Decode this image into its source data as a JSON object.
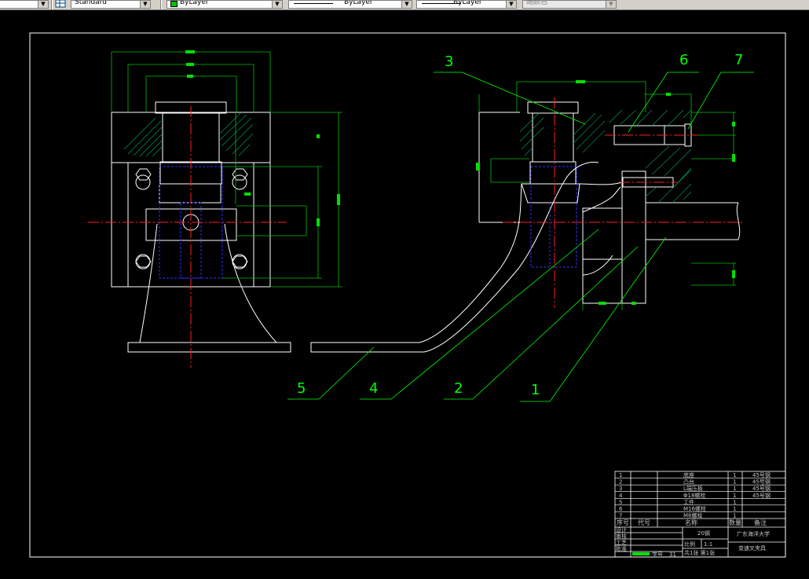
{
  "toolbar": {
    "text_style": "Standard",
    "layer_color": "ByLayer",
    "linetype": "ByLayer",
    "lineweight": "ByLayer",
    "plot_style": "随颜色"
  },
  "drawing": {
    "balloons": [
      "1",
      "2",
      "3",
      "4",
      "5",
      "6",
      "7"
    ]
  },
  "title_block": {
    "parts": [
      {
        "no": "1",
        "name": "底座",
        "qty": "1",
        "material": "45号钢"
      },
      {
        "no": "2",
        "name": "凸台",
        "qty": "1",
        "material": "45号钢"
      },
      {
        "no": "3",
        "name": "L端压板",
        "qty": "1",
        "material": "45号钢"
      },
      {
        "no": "4",
        "name": "Φ18螺栓",
        "qty": "1",
        "material": "45号钢"
      },
      {
        "no": "5",
        "name": "工件",
        "qty": "1",
        "material": ""
      },
      {
        "no": "6",
        "name": "M16螺栓",
        "qty": "1",
        "material": ""
      },
      {
        "no": "7",
        "name": "M8螺栓",
        "qty": "1",
        "material": ""
      }
    ],
    "header": {
      "seq": "序号",
      "code": "代号",
      "name": "名称",
      "qty": "数量",
      "note": "备注"
    },
    "fields": {
      "designer": "设计",
      "checker": "审核",
      "technologist": "工艺",
      "approver": "批准",
      "material": "20钢",
      "university": "广东海洋大学",
      "scale_label": "比例",
      "scale": "1:1",
      "sheets": "共1张  第1张",
      "part_name": "变速叉夹具",
      "student_no_label": "学号",
      "student_no": "31"
    }
  }
}
